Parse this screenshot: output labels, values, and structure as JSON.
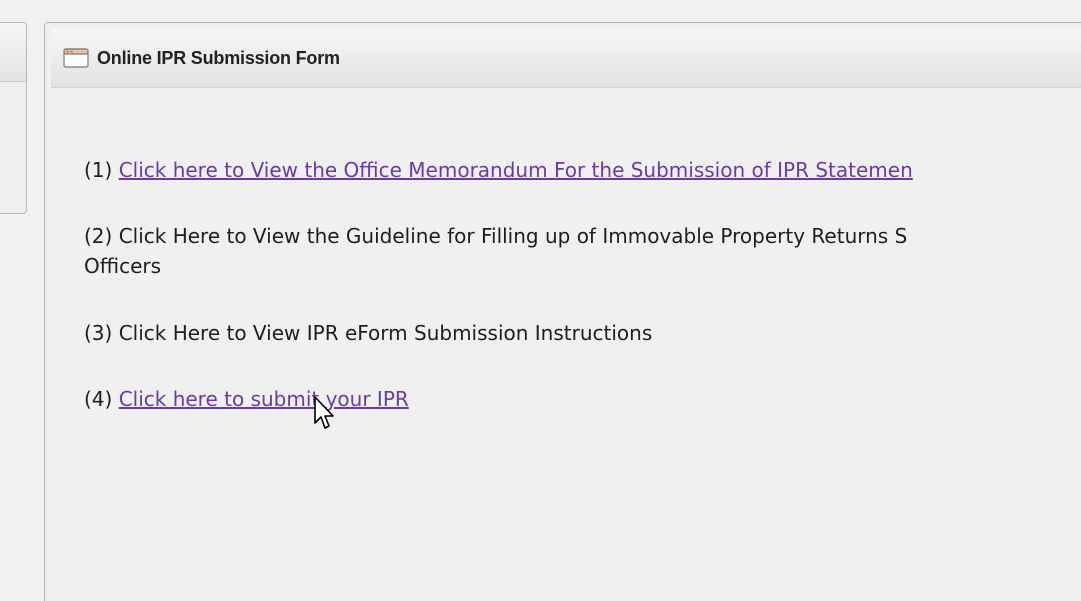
{
  "panel": {
    "title": "Online IPR Submission Form",
    "icon": "window-icon"
  },
  "items": [
    {
      "prefix": "(1) ",
      "link": "Click here to View the Office Memorandum For the Submission of IPR Statemen",
      "is_link": true
    },
    {
      "prefix": "(2) ",
      "text_line1": "Click Here to View the Guideline for Filling up of Immovable Property Returns S",
      "text_line2": "Officers",
      "is_link": false
    },
    {
      "prefix": "(3) ",
      "text": "Click Here to View IPR eForm Submission Instructions",
      "is_link": false
    },
    {
      "prefix": "(4) ",
      "link": "Click here to submit your IPR",
      "is_link": true
    }
  ],
  "colors": {
    "link": "#6a3aa8",
    "text": "#1e1e1e",
    "background": "#f0f0f0"
  }
}
